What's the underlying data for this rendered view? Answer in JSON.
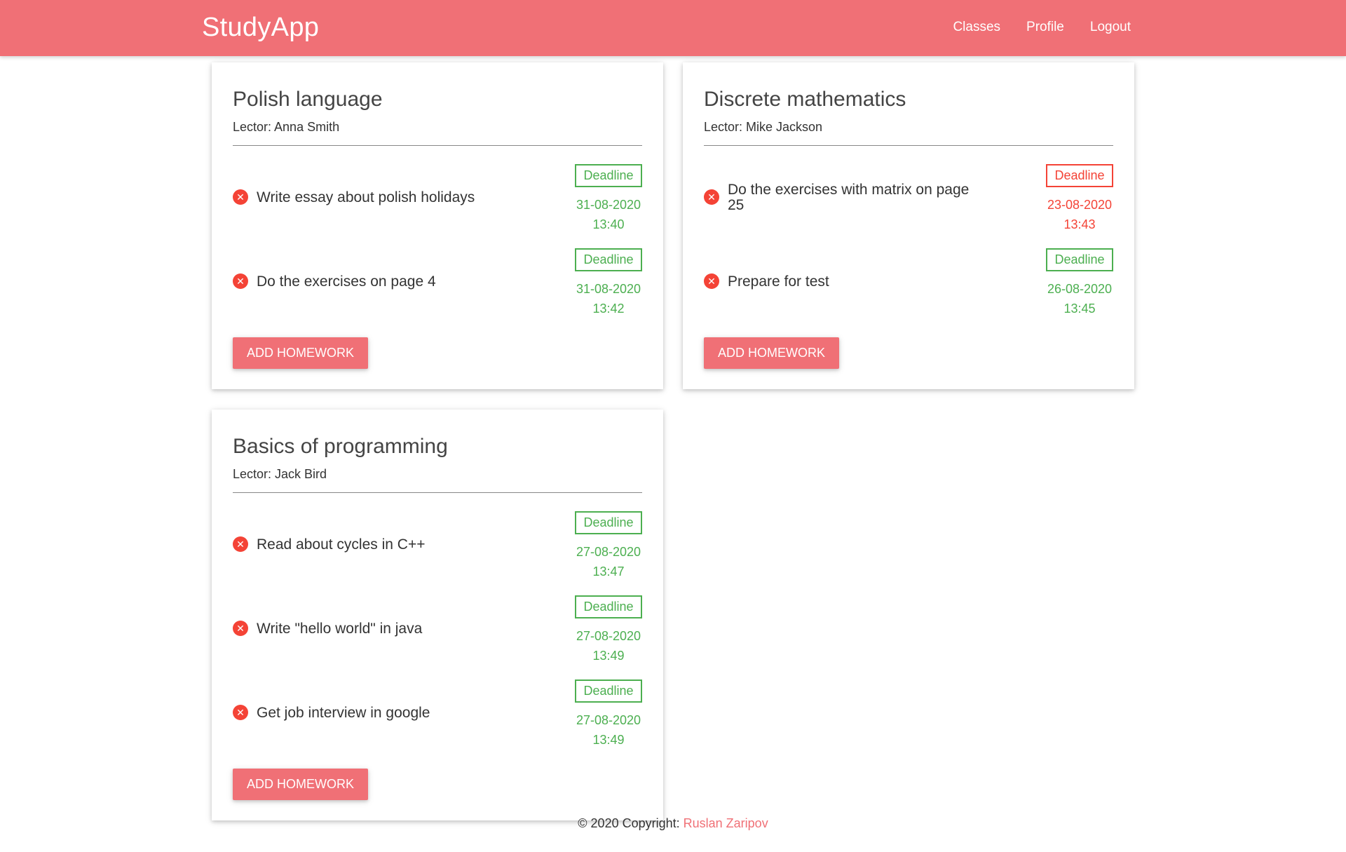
{
  "navbar": {
    "brand": "StudyApp",
    "links": [
      "Classes",
      "Profile",
      "Logout"
    ]
  },
  "classes": [
    {
      "title": "Polish language",
      "lector": "Lector: Anna Smith",
      "homework": [
        {
          "text": "Write essay about polish holidays",
          "deadline_label": "Deadline",
          "date": "31-08-2020",
          "time": "13:40",
          "status": "on-time"
        },
        {
          "text": "Do the exercises on page 4",
          "deadline_label": "Deadline",
          "date": "31-08-2020",
          "time": "13:42",
          "status": "on-time"
        }
      ],
      "add_button": "ADD HOMEWORK"
    },
    {
      "title": "Discrete mathematics",
      "lector": "Lector: Mike Jackson",
      "homework": [
        {
          "text": "Do the exercises with matrix on page 25",
          "deadline_label": "Deadline",
          "date": "23-08-2020",
          "time": "13:43",
          "status": "overdue"
        },
        {
          "text": "Prepare for test",
          "deadline_label": "Deadline",
          "date": "26-08-2020",
          "time": "13:45",
          "status": "on-time"
        }
      ],
      "add_button": "ADD HOMEWORK"
    },
    {
      "title": "Basics of programming",
      "lector": "Lector: Jack Bird",
      "homework": [
        {
          "text": "Read about cycles in C++",
          "deadline_label": "Deadline",
          "date": "27-08-2020",
          "time": "13:47",
          "status": "on-time"
        },
        {
          "text": "Write \"hello world\" in java",
          "deadline_label": "Deadline",
          "date": "27-08-2020",
          "time": "13:49",
          "status": "on-time"
        },
        {
          "text": "Get job interview in google",
          "deadline_label": "Deadline",
          "date": "27-08-2020",
          "time": "13:49",
          "status": "on-time"
        }
      ],
      "add_button": "ADD HOMEWORK"
    }
  ],
  "footer": {
    "copyright": "© 2020 Copyright: ",
    "author": "Ruslan Zaripov"
  },
  "colors": {
    "primary": "#f07076",
    "on_time": "#4caf50",
    "overdue": "#f44336"
  },
  "icons": {
    "remove": "close-circle-icon"
  }
}
